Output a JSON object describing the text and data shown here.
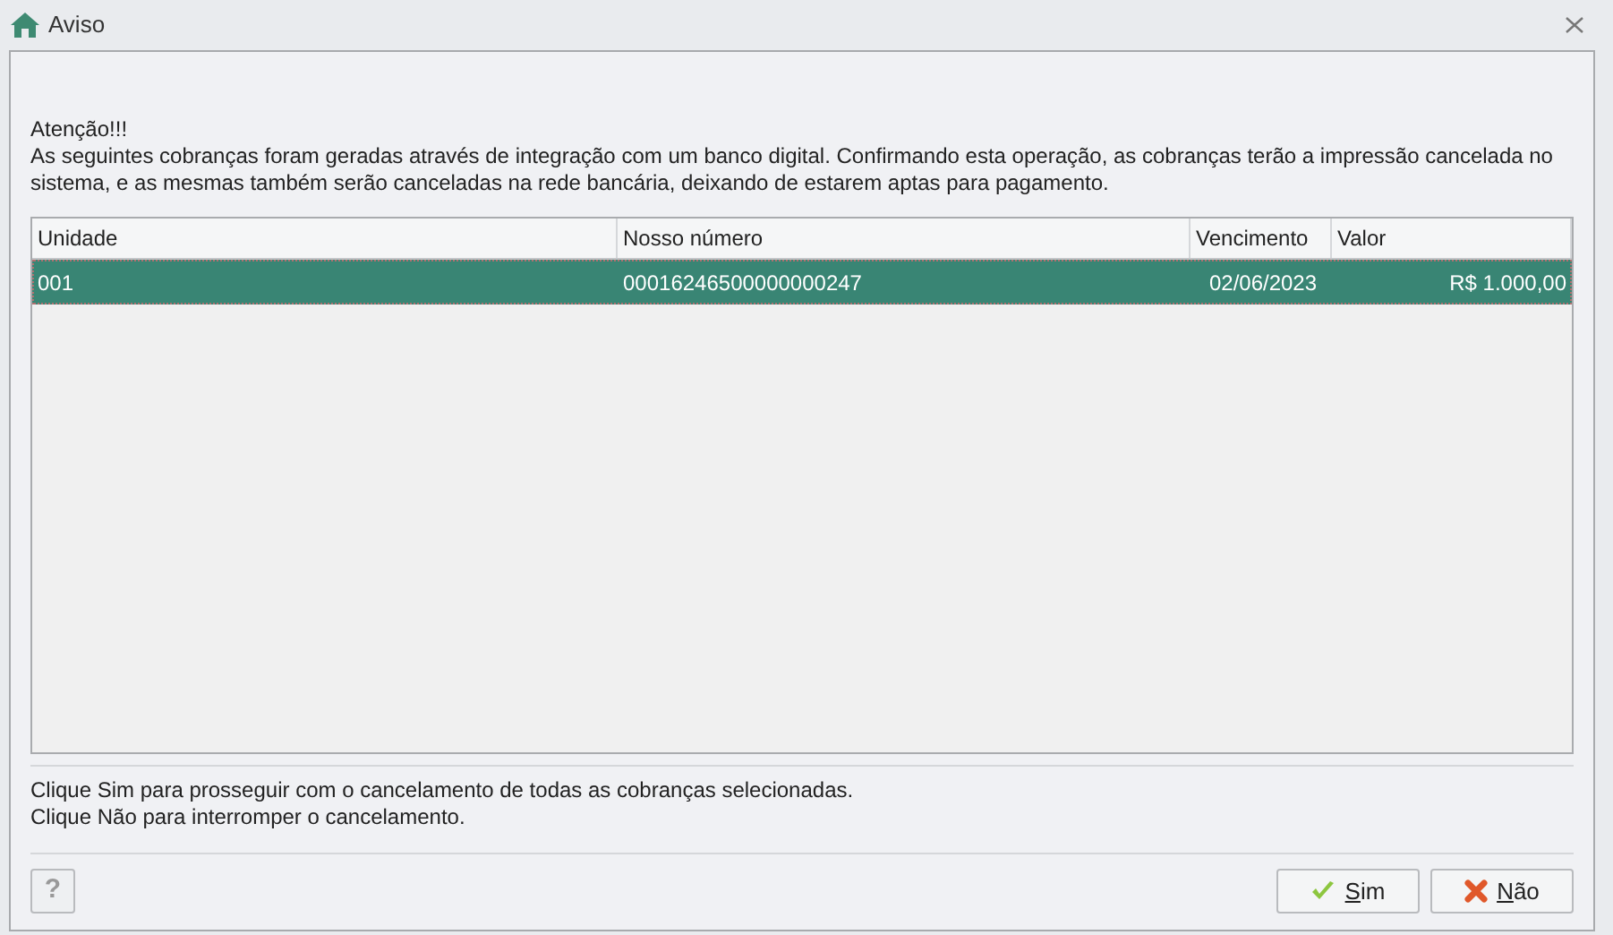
{
  "window": {
    "title": "Aviso"
  },
  "heading": "Atenção!!!",
  "message": "As seguintes cobranças foram geradas através de integração com um banco digital. Confirmando esta operação, as cobranças terão a impressão cancelada no sistema, e as mesmas também serão canceladas na rede bancária, deixando de estarem aptas para pagamento.",
  "table": {
    "columns": [
      "Unidade",
      "Nosso número",
      "Vencimento",
      "Valor"
    ],
    "rows": [
      {
        "selected": true,
        "cells": [
          "001",
          "00016246500000000247",
          "02/06/2023",
          "R$ 1.000,00"
        ]
      }
    ]
  },
  "instructions": [
    "Clique Sim para prosseguir com o cancelamento de todas as cobranças selecionadas.",
    "Clique Não para interromper o cancelamento."
  ],
  "help_button": "?",
  "buttons": [
    {
      "kind": "confirm",
      "label": "Sim"
    },
    {
      "kind": "cancel",
      "label": "Não"
    }
  ]
}
